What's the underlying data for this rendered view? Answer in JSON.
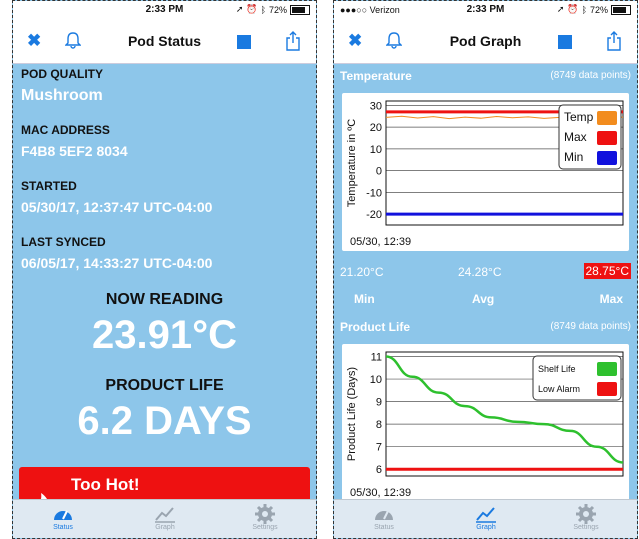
{
  "left": {
    "status_bar": {
      "time": "2:33 PM",
      "battery": "72%"
    },
    "nav": {
      "title": "Pod Status"
    },
    "fields": [
      {
        "label": "POD QUALITY",
        "value": "Mushroom"
      },
      {
        "label": "MAC ADDRESS",
        "value": "F4B8 5EF2 8034"
      },
      {
        "label": "STARTED",
        "value": "05/30/17, 12:37:47 UTC-04:00"
      },
      {
        "label": "LAST SYNCED",
        "value": "06/05/17, 14:33:27 UTC-04:00"
      }
    ],
    "now_reading_label": "NOW READING",
    "now_reading_value": "23.91°C",
    "product_life_label": "PRODUCT LIFE",
    "product_life_value": "6.2 DAYS",
    "alert": {
      "text": "Too Hot!",
      "color": "#ee1111"
    },
    "tabs": [
      {
        "label": "Status",
        "icon": "gauge-icon",
        "active": true
      },
      {
        "label": "Graph",
        "icon": "graph-icon",
        "active": false
      },
      {
        "label": "Settings",
        "icon": "gear-icon",
        "active": false
      }
    ]
  },
  "right": {
    "status_bar": {
      "carrier": "●●●○○ Verizon",
      "time": "2:33 PM",
      "battery": "72%"
    },
    "nav": {
      "title": "Pod Graph"
    },
    "temperature": {
      "header": "Temperature",
      "points": "(8749 data points)",
      "date_label": "05/30, 12:39",
      "min_value": "21.20°C",
      "avg_value": "24.28°C",
      "max_value": "28.75°C",
      "min_label": "Min",
      "avg_label": "Avg",
      "max_label": "Max"
    },
    "product_life": {
      "header": "Product Life",
      "points": "(8749 data points)",
      "date_label": "05/30, 12:39"
    },
    "tabs": [
      {
        "label": "Status",
        "icon": "gauge-icon",
        "active": false
      },
      {
        "label": "Graph",
        "icon": "graph-icon",
        "active": true
      },
      {
        "label": "Settings",
        "icon": "gear-icon",
        "active": false
      }
    ]
  },
  "chart_data": [
    {
      "type": "line",
      "ylabel": "Temperature in ºC",
      "ylim": [
        -25,
        32
      ],
      "yticks": [
        30,
        20,
        10,
        0,
        -10,
        -20
      ],
      "grid": true,
      "legend_position": "top-right",
      "series": [
        {
          "name": "Temp",
          "color": "#f28c1e",
          "values": [
            24.5,
            25.0,
            24.2,
            24.8,
            23.9,
            24.6,
            24.1,
            24.9,
            24.3,
            24.7,
            24.0,
            24.5,
            24.2,
            24.8,
            24.4,
            24.6
          ]
        },
        {
          "name": "Max",
          "color": "#ee1111",
          "values": [
            27,
            27,
            27,
            27,
            27,
            27,
            27,
            27,
            27,
            27,
            27,
            27,
            27,
            27,
            27,
            27
          ]
        },
        {
          "name": "Min",
          "color": "#1111dd",
          "values": [
            -20,
            -20,
            -20,
            -20,
            -20,
            -20,
            -20,
            -20,
            -20,
            -20,
            -20,
            -20,
            -20,
            -20,
            -20,
            -20
          ]
        }
      ]
    },
    {
      "type": "line",
      "ylabel": "Product Life (Days)",
      "ylim": [
        5.7,
        11.2
      ],
      "yticks": [
        11,
        10,
        9,
        8,
        7,
        6
      ],
      "grid": true,
      "legend_position": "top-right",
      "series": [
        {
          "name": "Shelf Life",
          "color": "#2ec02e",
          "values": [
            11,
            10.1,
            9.4,
            8.8,
            8.3,
            8.1,
            8.0,
            7.7,
            7.0,
            6.3
          ]
        },
        {
          "name": "Low Alarm",
          "color": "#ee1111",
          "values": [
            6,
            6,
            6,
            6,
            6,
            6,
            6,
            6,
            6,
            6
          ]
        }
      ]
    }
  ]
}
